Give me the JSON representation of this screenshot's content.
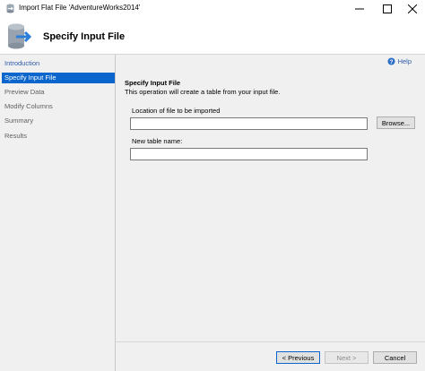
{
  "window": {
    "title": "Import Flat File 'AdventureWorks2014'",
    "icons": {
      "app": "database-import-icon",
      "minimize": "minimize-icon",
      "maximize": "maximize-icon",
      "close": "close-icon"
    }
  },
  "header": {
    "title": "Specify Input File",
    "icon": "database-arrow-icon"
  },
  "sidebar": {
    "items": [
      {
        "label": "Introduction",
        "state": "link"
      },
      {
        "label": "Specify Input File",
        "state": "selected"
      },
      {
        "label": "Preview Data",
        "state": "disabled"
      },
      {
        "label": "Modify Columns",
        "state": "disabled"
      },
      {
        "label": "Summary",
        "state": "disabled"
      },
      {
        "label": "Results",
        "state": "disabled"
      }
    ]
  },
  "main": {
    "help_label": "Help",
    "section_title": "Specify Input File",
    "section_description": "This operation will create a table from your input file.",
    "location_label": "Location of file to be imported",
    "location_value": "",
    "browse_label": "Browse...",
    "table_label": "New table name:",
    "table_value": ""
  },
  "footer": {
    "previous_label": "< Previous",
    "next_label": "Next >",
    "cancel_label": "Cancel"
  },
  "colors": {
    "selected_bg": "#0a66cc",
    "link": "#2e5aa8",
    "panel_bg": "#f0f0f0"
  }
}
